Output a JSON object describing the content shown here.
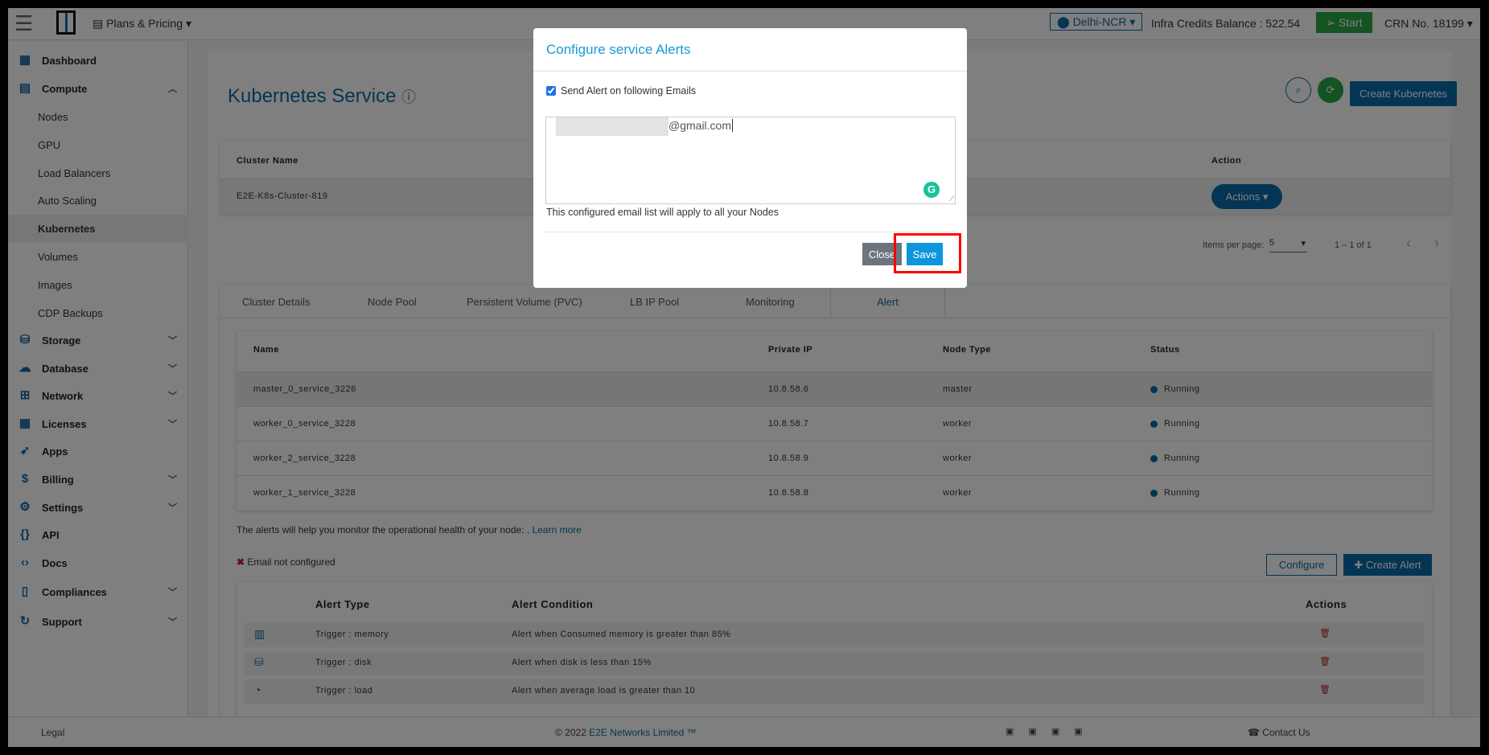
{
  "topbar": {
    "plans_label": "Plans & Pricing",
    "region": "Delhi-NCR",
    "credits": "Infra Credits Balance : 522.54",
    "start": "Start",
    "crn": "CRN No. 18199"
  },
  "sidebar": {
    "items": [
      {
        "label": "Dashboard",
        "type": "main",
        "icon": "dashboard-icon"
      },
      {
        "label": "Compute",
        "type": "main",
        "icon": "server-icon",
        "expanded": true
      },
      {
        "label": "Nodes",
        "type": "sub"
      },
      {
        "label": "GPU",
        "type": "sub"
      },
      {
        "label": "Load Balancers",
        "type": "sub"
      },
      {
        "label": "Auto Scaling",
        "type": "sub"
      },
      {
        "label": "Kubernetes",
        "type": "sub",
        "active": true
      },
      {
        "label": "Volumes",
        "type": "sub"
      },
      {
        "label": "Images",
        "type": "sub"
      },
      {
        "label": "CDP Backups",
        "type": "sub"
      },
      {
        "label": "Storage",
        "type": "main",
        "icon": "database-icon",
        "chevron": true
      },
      {
        "label": "Database",
        "type": "main",
        "icon": "cloud-database-icon",
        "chevron": true
      },
      {
        "label": "Network",
        "type": "main",
        "icon": "network-icon",
        "chevron": true
      },
      {
        "label": "Licenses",
        "type": "main",
        "icon": "grid-icon",
        "chevron": true
      },
      {
        "label": "Apps",
        "type": "main",
        "icon": "rocket-icon"
      },
      {
        "label": "Billing",
        "type": "main",
        "icon": "billing-icon",
        "chevron": true
      },
      {
        "label": "Settings",
        "type": "main",
        "icon": "gear-icon",
        "chevron": true
      },
      {
        "label": "API",
        "type": "main",
        "icon": "braces-icon"
      },
      {
        "label": "Docs",
        "type": "main",
        "icon": "code-icon"
      },
      {
        "label": "Compliances",
        "type": "main",
        "icon": "document-icon",
        "chevron": true
      },
      {
        "label": "Support",
        "type": "main",
        "icon": "support-icon",
        "chevron": true
      }
    ]
  },
  "page": {
    "title": "Kubernetes Service",
    "create_button": "Create Kubernetes"
  },
  "cluster_table": {
    "headers": {
      "name": "Cluster Name",
      "action": "Action"
    },
    "rows": [
      {
        "name": "E2E-K8s-Cluster-819",
        "action": "Actions"
      }
    ]
  },
  "pagination": {
    "items_per_page_label": "Items per page:",
    "items_per_page": "5",
    "range": "1 – 1 of 1"
  },
  "tabs": [
    {
      "label": "Cluster Details"
    },
    {
      "label": "Node Pool"
    },
    {
      "label": "Persistent Volume (PVC)"
    },
    {
      "label": "LB IP Pool"
    },
    {
      "label": "Monitoring"
    },
    {
      "label": "Alert",
      "active": true
    }
  ],
  "nodes_table": {
    "headers": [
      "Name",
      "Private IP",
      "Node Type",
      "Status"
    ],
    "rows": [
      [
        "master_0_service_3226",
        "10.8.58.6",
        "master",
        "Running"
      ],
      [
        "worker_0_service_3228",
        "10.8.58.7",
        "worker",
        "Running"
      ],
      [
        "worker_2_service_3228",
        "10.8.58.9",
        "worker",
        "Running"
      ],
      [
        "worker_1_service_3228",
        "10.8.58.8",
        "worker",
        "Running"
      ]
    ]
  },
  "alerts": {
    "info": "The alerts will help you monitor the operational health of your node: .",
    "learn_more": "Learn more",
    "email_status": "Email not configured",
    "configure": "Configure",
    "create_alert": "Create Alert",
    "headers": {
      "type": "Alert Type",
      "condition": "Alert Condition",
      "actions": "Actions"
    },
    "rows": [
      {
        "icon": "bar-chart-icon",
        "type": "Trigger : memory",
        "condition": "Alert when Consumed memory is greater than 85%"
      },
      {
        "icon": "database-icon",
        "type": "Trigger : disk",
        "condition": "Alert when disk is less than 15%"
      },
      {
        "icon": "gauge-icon",
        "type": "Trigger : load",
        "condition": "Alert when average load is greater than 10"
      }
    ]
  },
  "footer": {
    "legal": "Legal",
    "copyright_prefix": "© 2022",
    "company": "E2E Networks Limited ™",
    "contact": "Contact Us"
  },
  "modal": {
    "title": "Configure service Alerts",
    "checkbox_label": "Send Alert on following Emails",
    "checked": true,
    "email_visible": "@gmail.com",
    "help": "This configured email list will apply to all your Nodes",
    "close": "Close",
    "save": "Save"
  },
  "colors": {
    "brand": "#0b6aa8",
    "start_green": "#28a745",
    "highlight": "#ff0000",
    "danger": "#c62828"
  }
}
